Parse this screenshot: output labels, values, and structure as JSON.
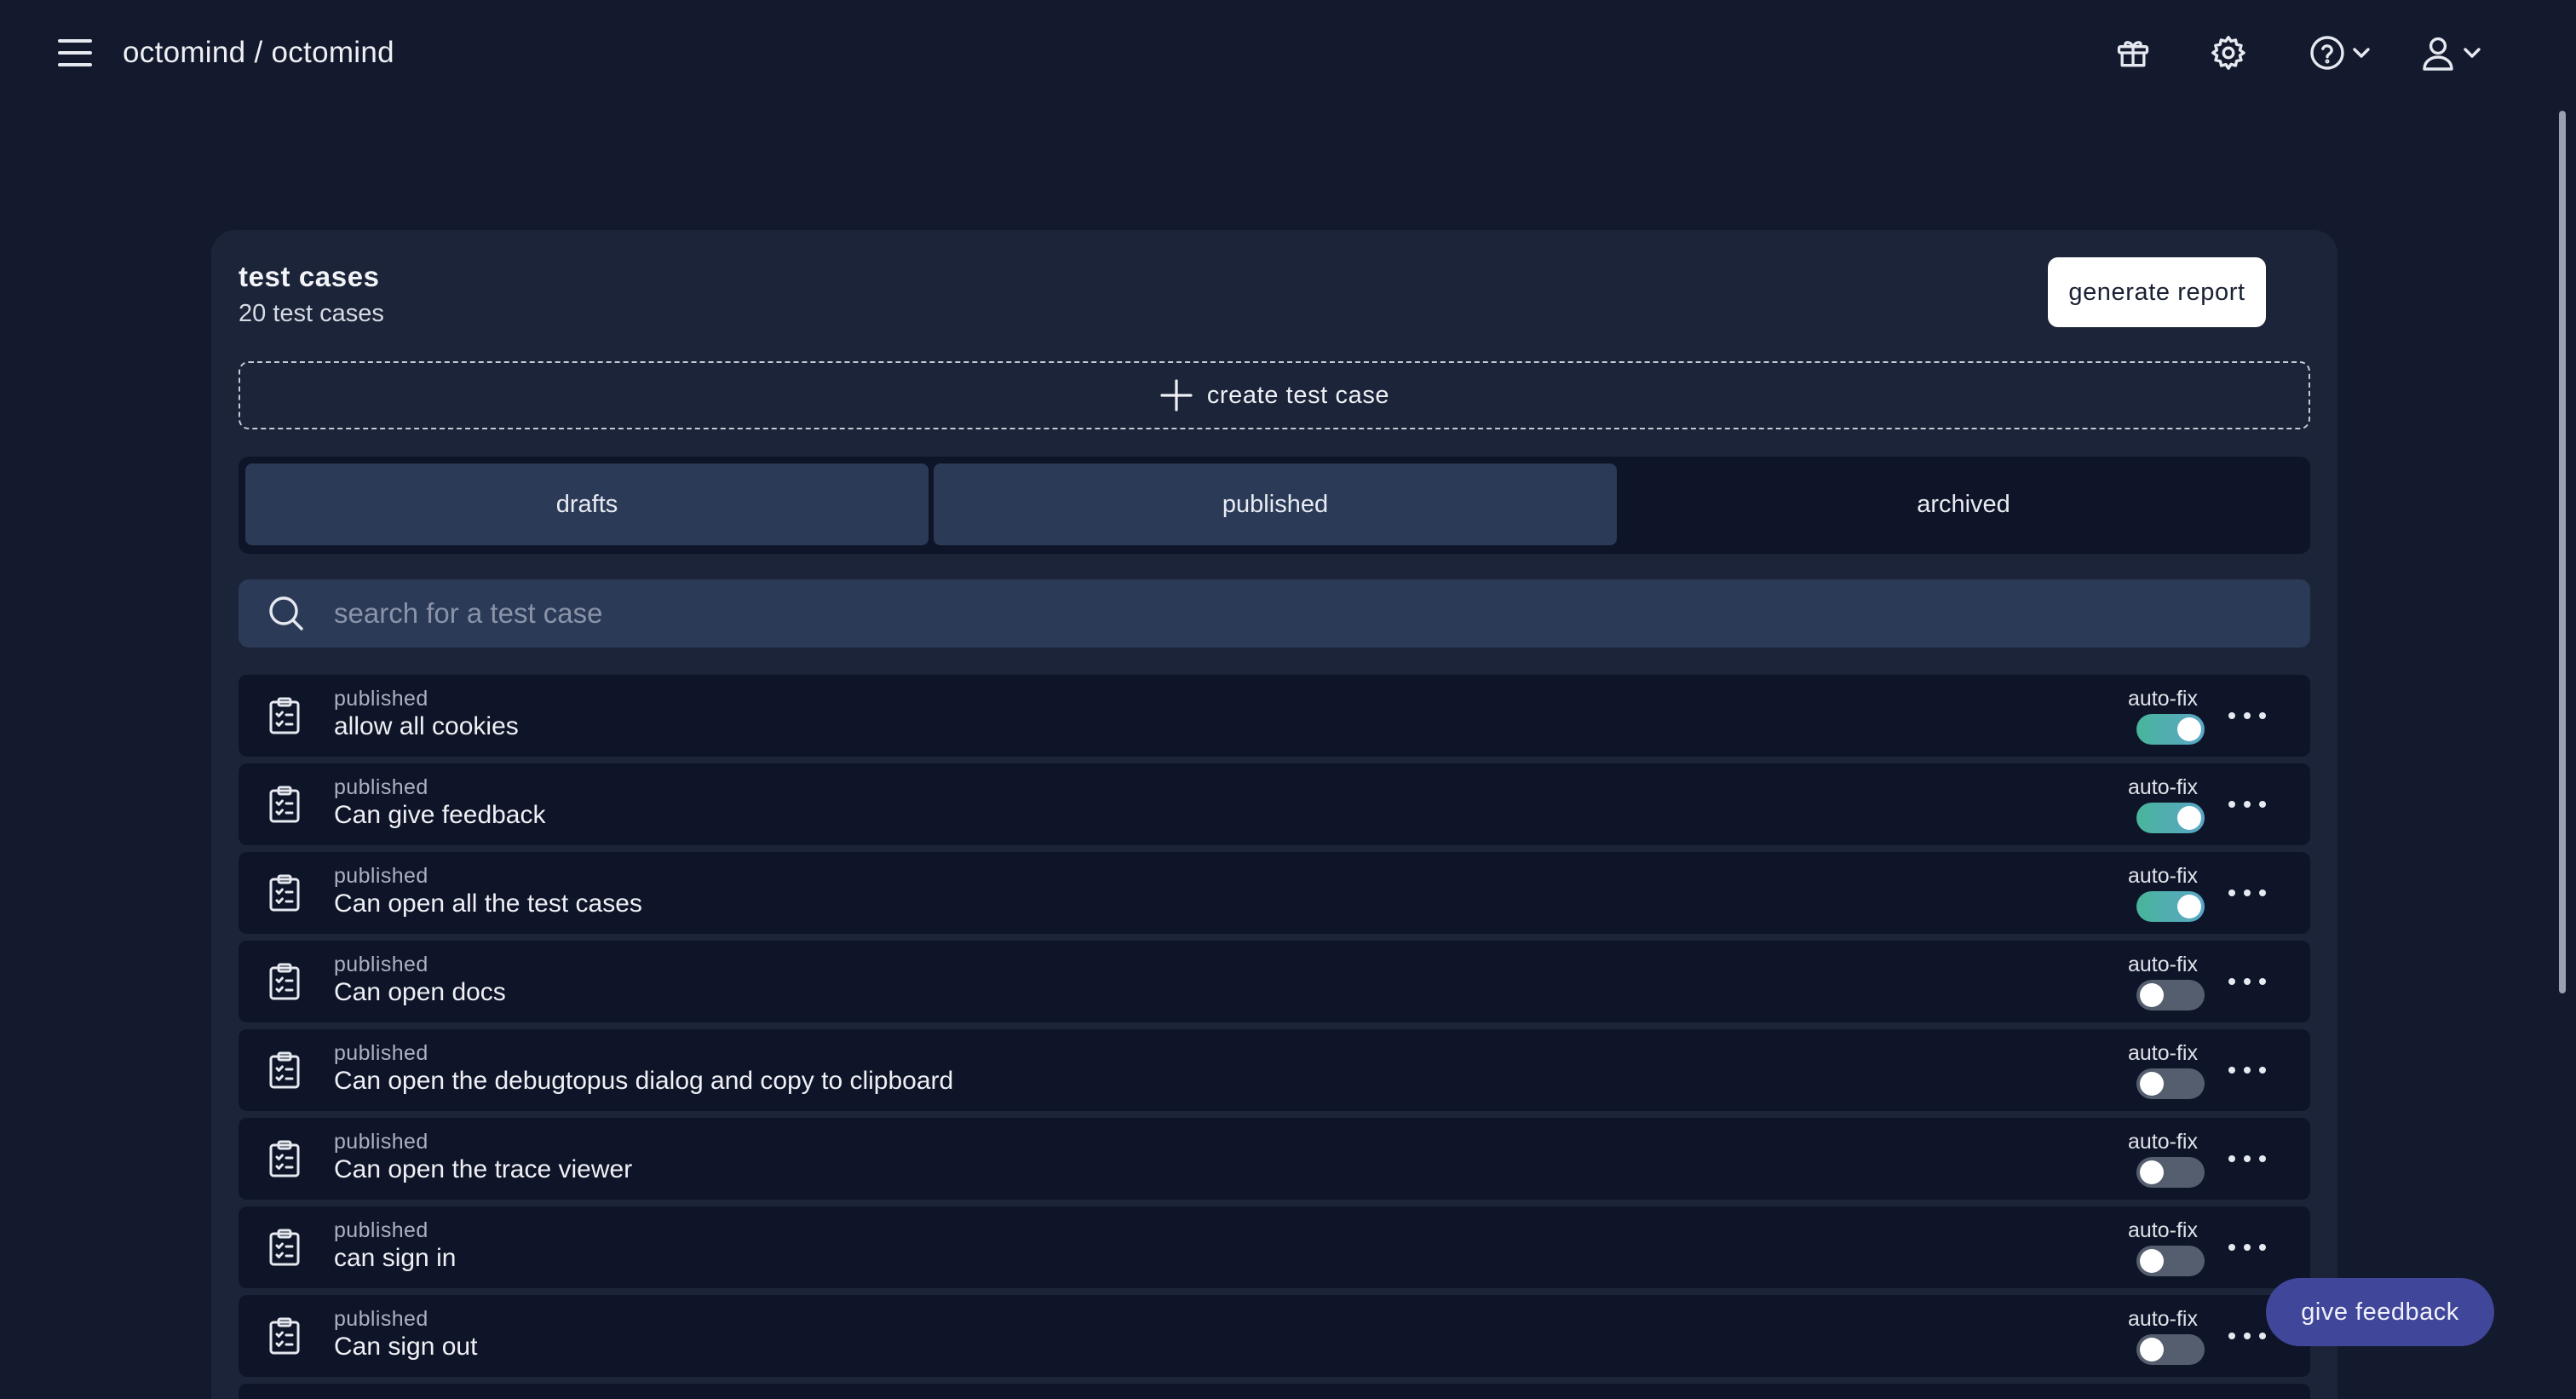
{
  "header": {
    "title": "octomind / octomind",
    "icons": [
      "menu-icon",
      "gift-icon",
      "gear-icon",
      "help-icon",
      "user-icon"
    ]
  },
  "panel": {
    "title": "test cases",
    "count": "20 test cases",
    "generate_report_label": "generate report",
    "create_label": "create test case"
  },
  "tabs": [
    {
      "label": "drafts",
      "active": true
    },
    {
      "label": "published",
      "active": true
    },
    {
      "label": "archived",
      "active": false
    }
  ],
  "search": {
    "placeholder": "search for a test case",
    "value": ""
  },
  "test_cases": [
    {
      "status": "published",
      "name": "allow all cookies",
      "auto_fix_label": "auto-fix",
      "auto_fix": true
    },
    {
      "status": "published",
      "name": "Can give feedback",
      "auto_fix_label": "auto-fix",
      "auto_fix": true
    },
    {
      "status": "published",
      "name": "Can open all the test cases",
      "auto_fix_label": "auto-fix",
      "auto_fix": true
    },
    {
      "status": "published",
      "name": "Can open docs",
      "auto_fix_label": "auto-fix",
      "auto_fix": false
    },
    {
      "status": "published",
      "name": "Can open the debugtopus dialog and copy to clipboard",
      "auto_fix_label": "auto-fix",
      "auto_fix": false
    },
    {
      "status": "published",
      "name": "Can open the trace viewer",
      "auto_fix_label": "auto-fix",
      "auto_fix": false
    },
    {
      "status": "published",
      "name": "can sign in",
      "auto_fix_label": "auto-fix",
      "auto_fix": false
    },
    {
      "status": "published",
      "name": "Can sign out",
      "auto_fix_label": "auto-fix",
      "auto_fix": false
    }
  ],
  "feedback_label": "give feedback",
  "colors": {
    "background": "#131a2d",
    "panel": "#1b2438",
    "row": "#0f1528",
    "tab_active": "#2b3a57",
    "toggle_on": "#49b49a",
    "toggle_off": "#555e6f",
    "feedback_button": "#40469a"
  }
}
